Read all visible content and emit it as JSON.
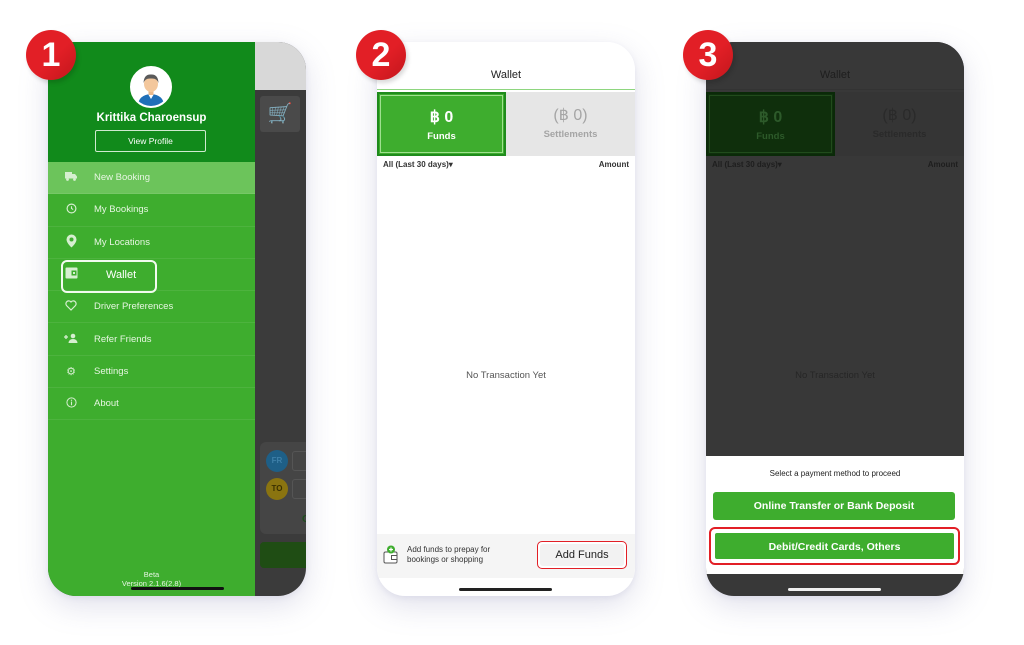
{
  "steps": [
    "1",
    "2",
    "3"
  ],
  "colors": {
    "brand_green": "#3ead2e",
    "dark_green": "#118a1b",
    "menu_active": "#6cc45b",
    "highlight_red": "#e21f26"
  },
  "screen1": {
    "drawer": {
      "user_name": "Krittika Charoensup",
      "view_profile_label": "View Profile",
      "menu_items": [
        {
          "label": "New Booking",
          "icon": "truck-icon",
          "active": true
        },
        {
          "label": "My Bookings",
          "icon": "history-icon"
        },
        {
          "label": "My Locations",
          "icon": "location-pin-icon"
        },
        {
          "label": "Wallet",
          "icon": "wallet-icon",
          "highlighted": true
        },
        {
          "label": "Driver Preferences",
          "icon": "heart-icon"
        },
        {
          "label": "Refer Friends",
          "icon": "add-user-icon"
        },
        {
          "label": "Settings",
          "icon": "gear-icon"
        },
        {
          "label": "About",
          "icon": "info-icon"
        }
      ],
      "footer_beta": "Beta",
      "footer_version": "Version 2.1.6(2.8)"
    },
    "background": {
      "menu_icon": "hamburger-icon",
      "pin_from": "FR",
      "pin_to": "TO",
      "card_text": "O"
    }
  },
  "wallet": {
    "back_icon": "‹",
    "title": "Wallet",
    "funds_amount": "฿ 0",
    "funds_label": "Funds",
    "settlements_amount": "(฿ 0)",
    "settlements_label": "Settlements",
    "filter_label": "All (Last 30 days)▾",
    "amount_header": "Amount",
    "empty_message": "No Transaction Yet",
    "add_funds_hint": "Add funds to prepay for bookings or shopping",
    "add_funds_button": "Add Funds"
  },
  "screen3": {
    "sheet_title": "Select a payment method to proceed",
    "payment_options": [
      "Online Transfer or Bank Deposit",
      "Debit/Credit Cards, Others"
    ]
  }
}
